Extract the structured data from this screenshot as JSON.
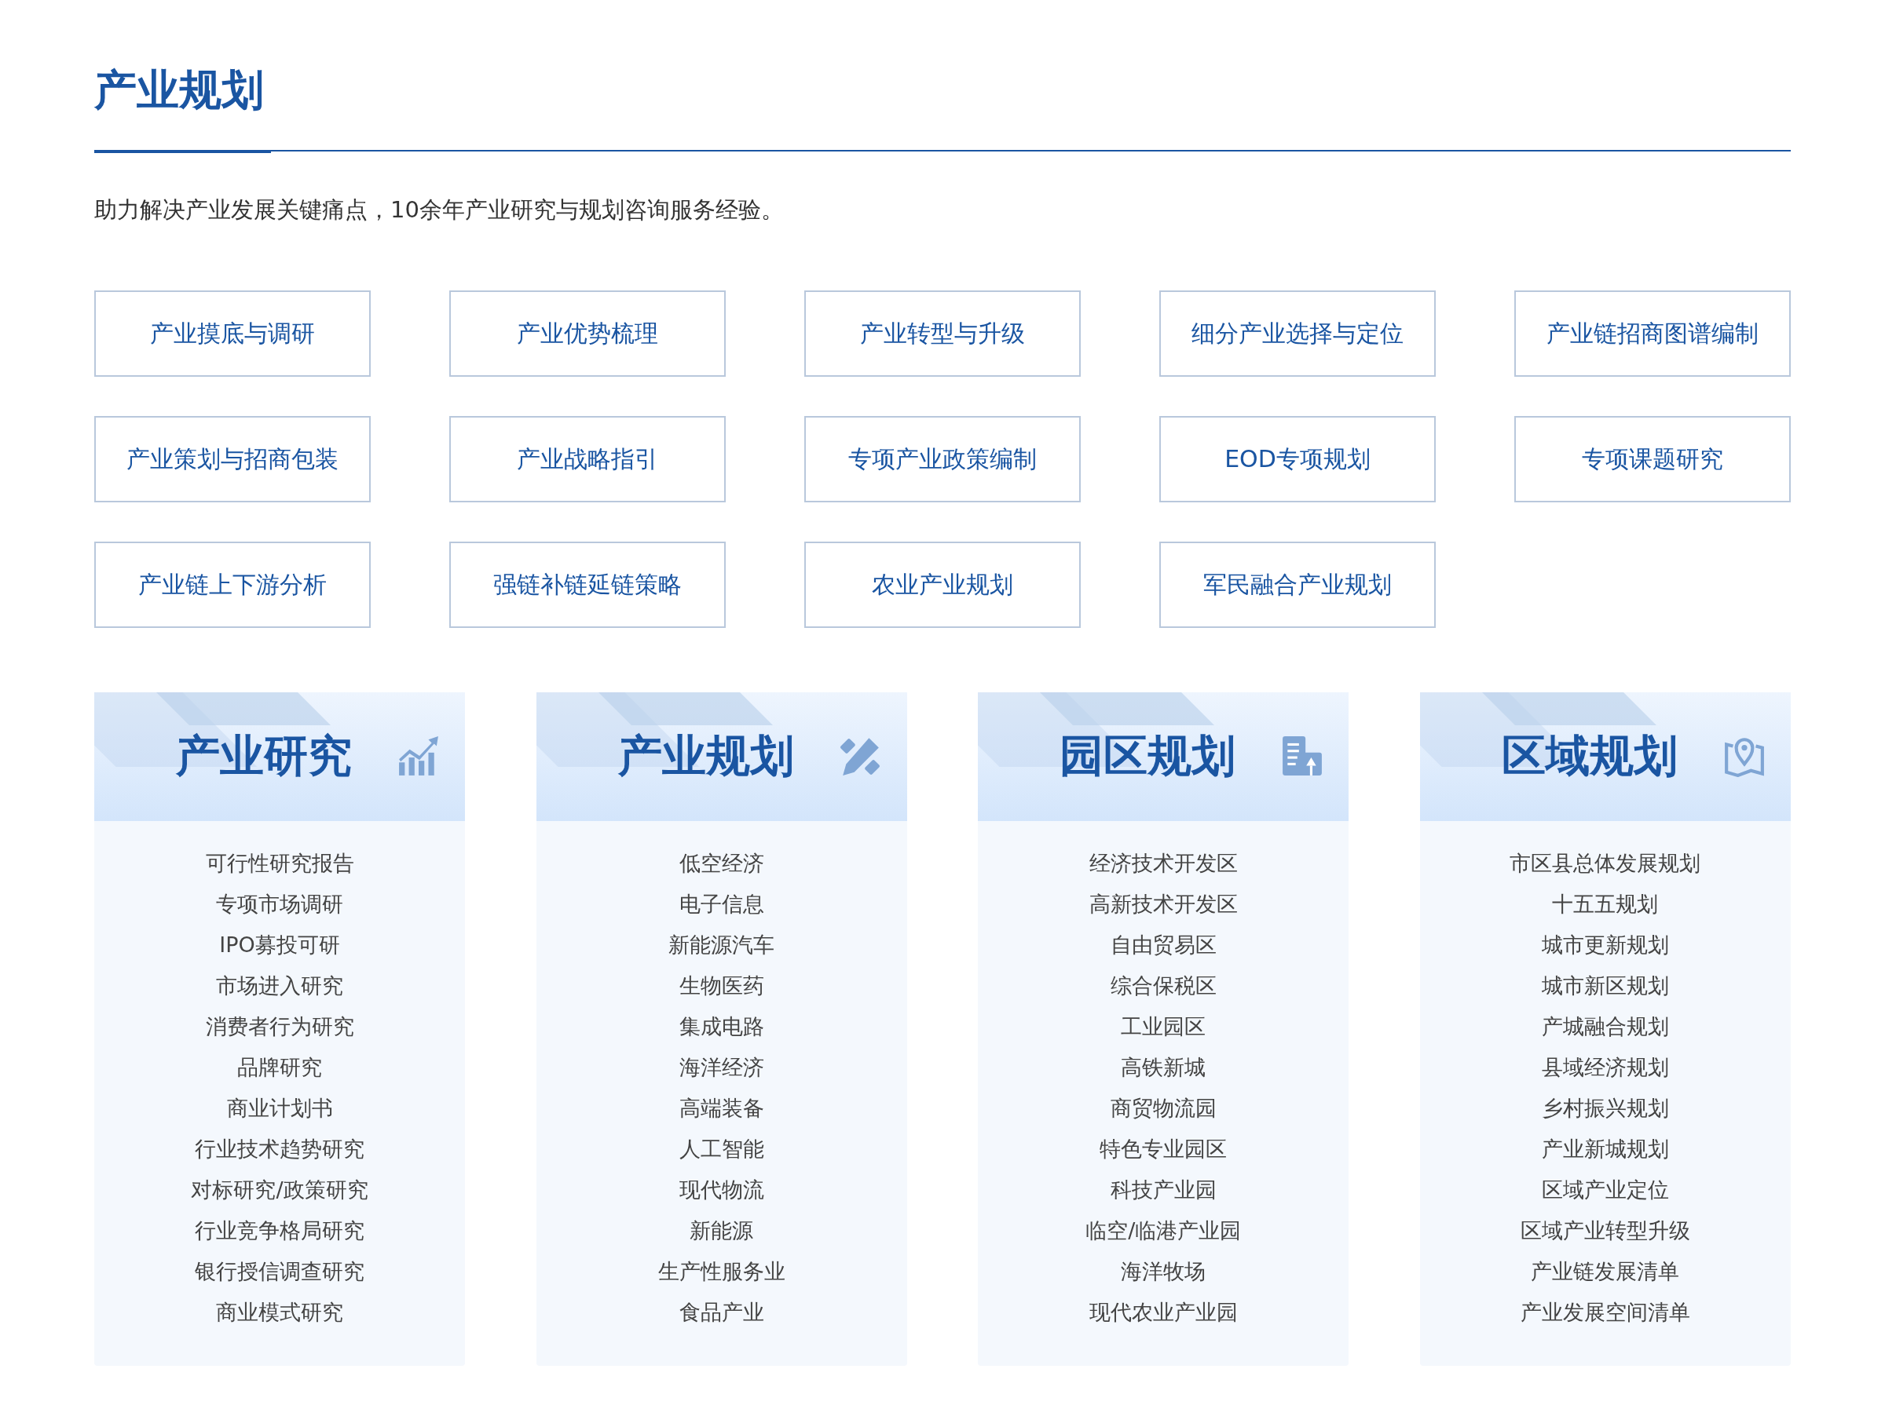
{
  "title": "产业规划",
  "subtitle": "助力解决产业发展关键痛点，10余年产业研究与规划咨询服务经验。",
  "services": [
    "产业摸底与调研",
    "产业优势梳理",
    "产业转型与升级",
    "细分产业选择与定位",
    "产业链招商图谱编制",
    "产业策划与招商包装",
    "产业战略指引",
    "专项产业政策编制",
    "EOD专项规划",
    "专项课题研究",
    "产业链上下游分析",
    "强链补链延链策略",
    "农业产业规划",
    "军民融合产业规划"
  ],
  "cards": [
    {
      "title": "产业研究",
      "kind": "chart",
      "items": [
        "可行性研究报告",
        "专项市场调研",
        "IPO募投可研",
        "市场进入研究",
        "消费者行为研究",
        "品牌研究",
        "商业计划书",
        "行业技术趋势研究",
        "对标研究/政策研究",
        "行业竞争格局研究",
        "银行授信调查研究",
        "商业模式研究"
      ]
    },
    {
      "title": "产业规划",
      "kind": "tools",
      "items": [
        "低空经济",
        "电子信息",
        "新能源汽车",
        "生物医药",
        "集成电路",
        "海洋经济",
        "高端装备",
        "人工智能",
        "现代物流",
        "新能源",
        "生产性服务业",
        "食品产业"
      ]
    },
    {
      "title": "园区规划",
      "kind": "document",
      "items": [
        "经济技术开发区",
        "高新技术开发区",
        "自由贸易区",
        "综合保税区",
        "工业园区",
        "高铁新城",
        "商贸物流园",
        "特色专业园区",
        "科技产业园",
        "临空/临港产业园",
        "海洋牧场",
        "现代农业产业园"
      ]
    },
    {
      "title": "区域规划",
      "kind": "map",
      "items": [
        "市区县总体发展规划",
        "十五五规划",
        "城市更新规划",
        "城市新区规划",
        "产城融合规划",
        "县域经济规划",
        "乡村振兴规划",
        "产业新城规划",
        "区域产业定位",
        "区域产业转型升级",
        "产业链发展清单",
        "产业发展空间清单"
      ]
    }
  ]
}
